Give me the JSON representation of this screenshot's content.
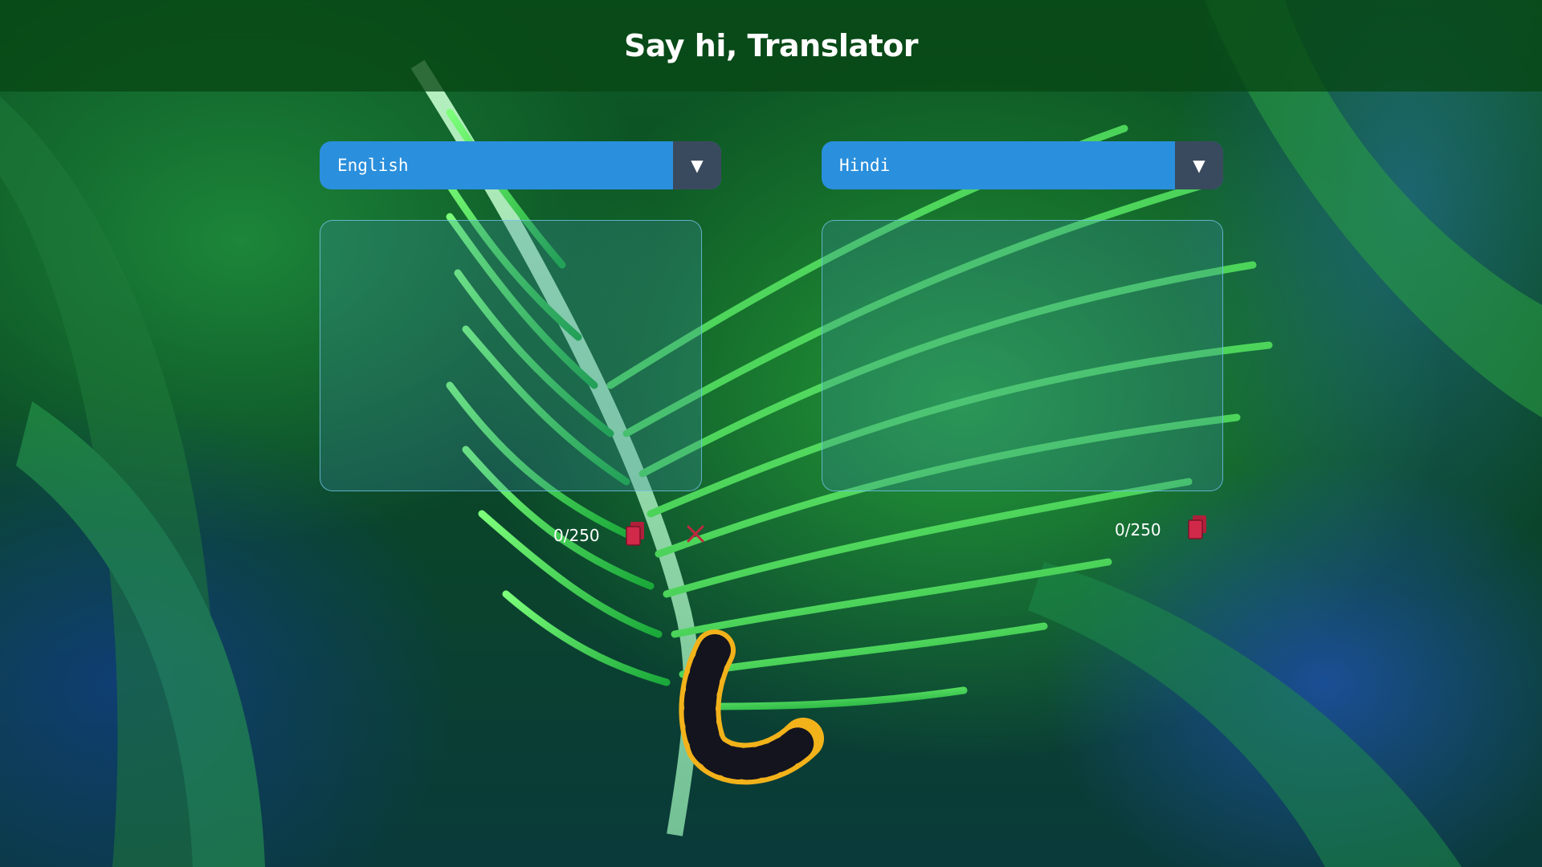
{
  "header": {
    "title": "Say hi, Translator"
  },
  "source": {
    "language": "English",
    "text_value": "",
    "counter": "0/250",
    "copy_icon": "copy-icon",
    "clear_icon": "close-icon"
  },
  "target": {
    "language": "Hindi",
    "text_value": "",
    "counter": "0/250",
    "copy_icon": "copy-icon"
  },
  "colors": {
    "select_bg": "#2a8fdc",
    "select_arrow_bg": "#3a4a5e",
    "icon_red": "#b0203a",
    "header_bg": "#08461a"
  }
}
